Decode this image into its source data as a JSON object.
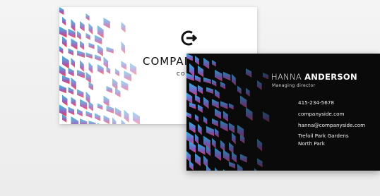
{
  "back_card": {
    "company_name": "COMPANY",
    "company_sub": "CO"
  },
  "front_card": {
    "first_name": "HANNA",
    "last_name": "ANDERSON",
    "title": "Managing director",
    "phone": "415-234-5678",
    "website": "companyside.com",
    "email": "hanna@companyside.com",
    "address_line1": "Trefoil Park Gardens",
    "address_line2": "North Park"
  },
  "icons": {
    "logo": "circle-arrow-exit-icon"
  },
  "colors": {
    "back_card_bg": "#ffffff",
    "front_card_bg": "#0a0a0a",
    "pattern_top": "#2aa8d8",
    "pattern_mid": "#7b5bb8",
    "pattern_bottom": "#e8476a",
    "pattern_accent": "#f59a3c"
  }
}
